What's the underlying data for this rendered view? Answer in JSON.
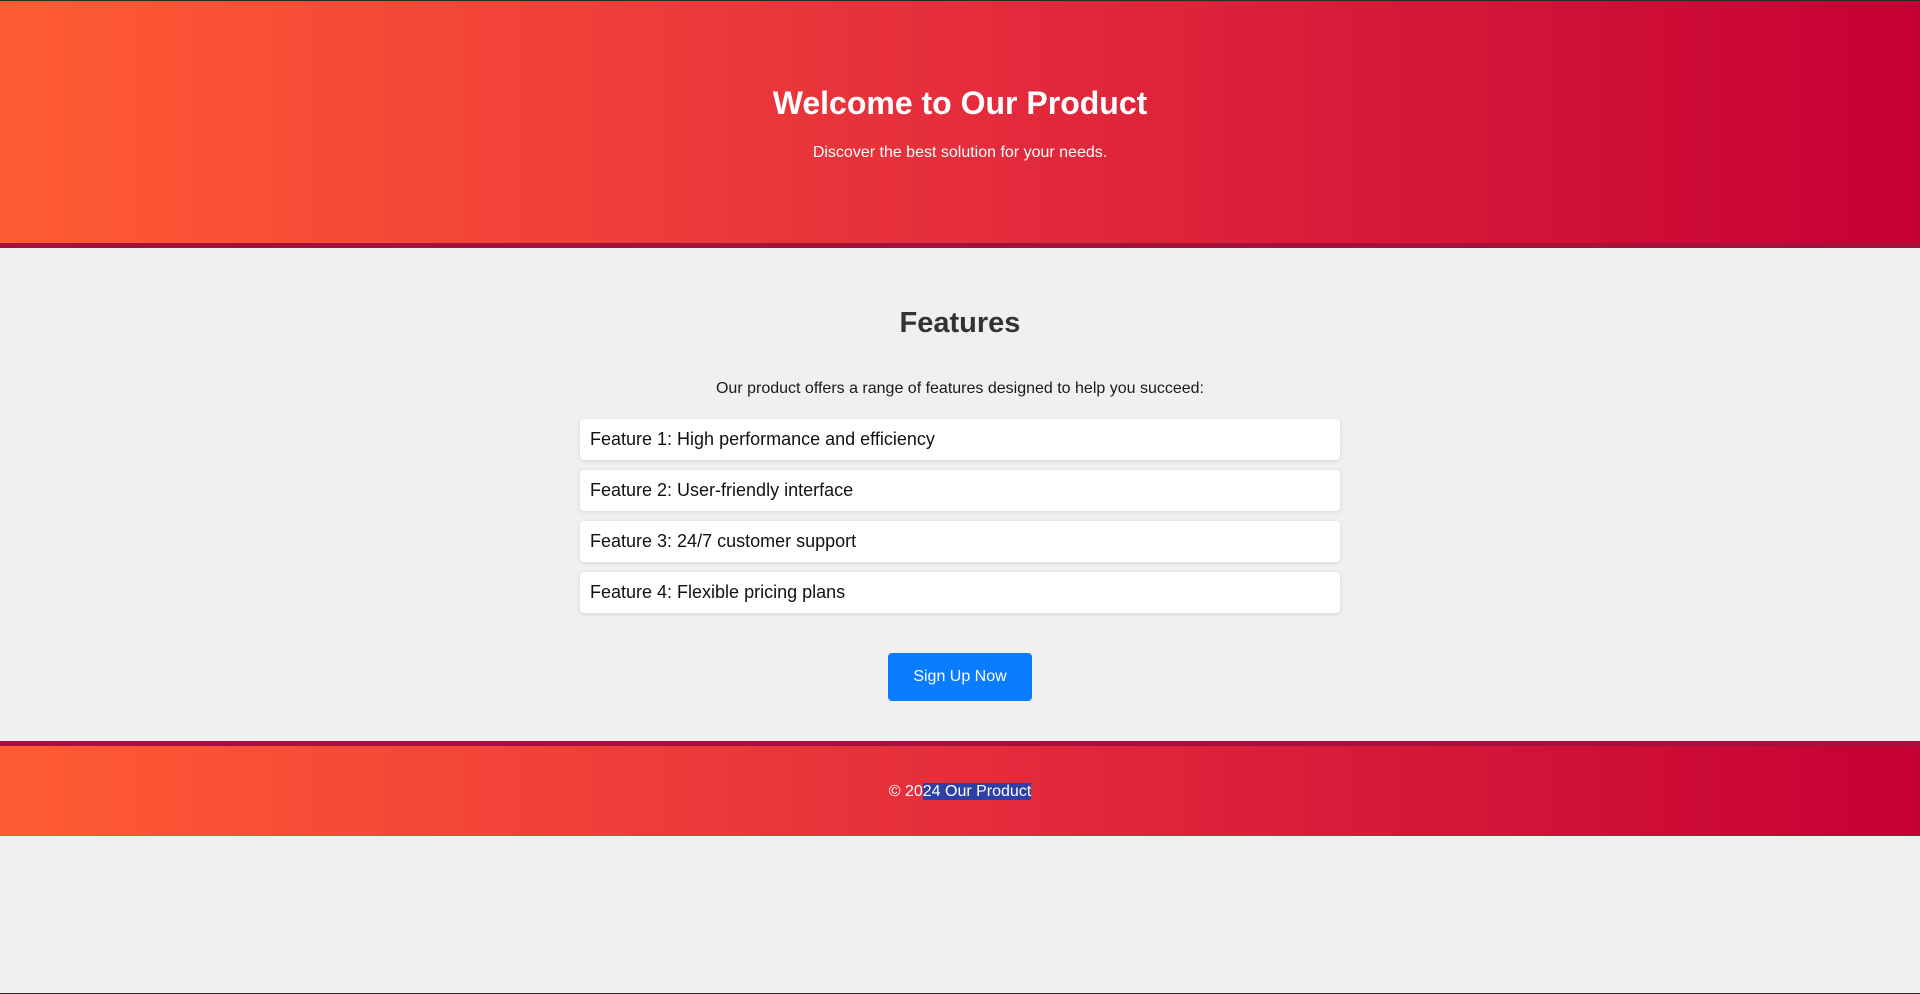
{
  "header": {
    "title": "Welcome to Our Product",
    "subtitle": "Discover the best solution for your needs."
  },
  "features": {
    "heading": "Features",
    "intro": "Our product offers a range of features designed to help you succeed:",
    "items": [
      "Feature 1: High performance and efficiency",
      "Feature 2: User-friendly interface",
      "Feature 3: 24/7 customer support",
      "Feature 4: Flexible pricing plans"
    ],
    "cta_label": "Sign Up Now"
  },
  "footer": {
    "copyright_prefix": "© 20",
    "copyright_selected": "24 Our Product"
  },
  "colors": {
    "gradient_start": "#ff5c33",
    "gradient_end": "#c50034",
    "button": "#0a7cff",
    "background": "#f0f0f0",
    "selection": "#2f3fa8"
  }
}
